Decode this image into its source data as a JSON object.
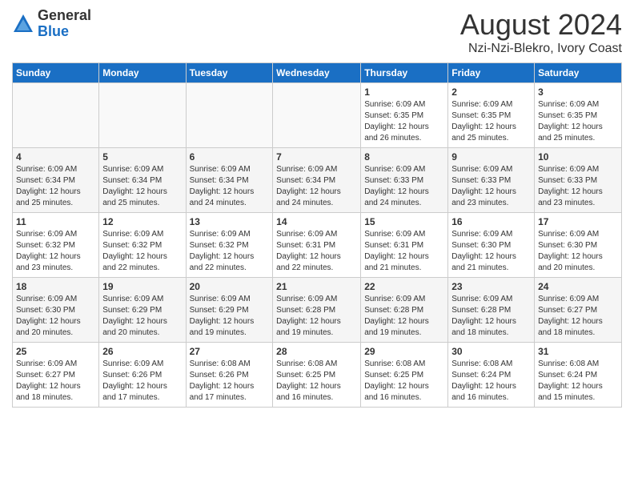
{
  "logo": {
    "general": "General",
    "blue": "Blue"
  },
  "title": "August 2024",
  "location": "Nzi-Nzi-Blekro, Ivory Coast",
  "days_header": [
    "Sunday",
    "Monday",
    "Tuesday",
    "Wednesday",
    "Thursday",
    "Friday",
    "Saturday"
  ],
  "weeks": [
    [
      {
        "day": "",
        "info": ""
      },
      {
        "day": "",
        "info": ""
      },
      {
        "day": "",
        "info": ""
      },
      {
        "day": "",
        "info": ""
      },
      {
        "day": "1",
        "info": "Sunrise: 6:09 AM\nSunset: 6:35 PM\nDaylight: 12 hours\nand 26 minutes."
      },
      {
        "day": "2",
        "info": "Sunrise: 6:09 AM\nSunset: 6:35 PM\nDaylight: 12 hours\nand 25 minutes."
      },
      {
        "day": "3",
        "info": "Sunrise: 6:09 AM\nSunset: 6:35 PM\nDaylight: 12 hours\nand 25 minutes."
      }
    ],
    [
      {
        "day": "4",
        "info": "Sunrise: 6:09 AM\nSunset: 6:34 PM\nDaylight: 12 hours\nand 25 minutes."
      },
      {
        "day": "5",
        "info": "Sunrise: 6:09 AM\nSunset: 6:34 PM\nDaylight: 12 hours\nand 25 minutes."
      },
      {
        "day": "6",
        "info": "Sunrise: 6:09 AM\nSunset: 6:34 PM\nDaylight: 12 hours\nand 24 minutes."
      },
      {
        "day": "7",
        "info": "Sunrise: 6:09 AM\nSunset: 6:34 PM\nDaylight: 12 hours\nand 24 minutes."
      },
      {
        "day": "8",
        "info": "Sunrise: 6:09 AM\nSunset: 6:33 PM\nDaylight: 12 hours\nand 24 minutes."
      },
      {
        "day": "9",
        "info": "Sunrise: 6:09 AM\nSunset: 6:33 PM\nDaylight: 12 hours\nand 23 minutes."
      },
      {
        "day": "10",
        "info": "Sunrise: 6:09 AM\nSunset: 6:33 PM\nDaylight: 12 hours\nand 23 minutes."
      }
    ],
    [
      {
        "day": "11",
        "info": "Sunrise: 6:09 AM\nSunset: 6:32 PM\nDaylight: 12 hours\nand 23 minutes."
      },
      {
        "day": "12",
        "info": "Sunrise: 6:09 AM\nSunset: 6:32 PM\nDaylight: 12 hours\nand 22 minutes."
      },
      {
        "day": "13",
        "info": "Sunrise: 6:09 AM\nSunset: 6:32 PM\nDaylight: 12 hours\nand 22 minutes."
      },
      {
        "day": "14",
        "info": "Sunrise: 6:09 AM\nSunset: 6:31 PM\nDaylight: 12 hours\nand 22 minutes."
      },
      {
        "day": "15",
        "info": "Sunrise: 6:09 AM\nSunset: 6:31 PM\nDaylight: 12 hours\nand 21 minutes."
      },
      {
        "day": "16",
        "info": "Sunrise: 6:09 AM\nSunset: 6:30 PM\nDaylight: 12 hours\nand 21 minutes."
      },
      {
        "day": "17",
        "info": "Sunrise: 6:09 AM\nSunset: 6:30 PM\nDaylight: 12 hours\nand 20 minutes."
      }
    ],
    [
      {
        "day": "18",
        "info": "Sunrise: 6:09 AM\nSunset: 6:30 PM\nDaylight: 12 hours\nand 20 minutes."
      },
      {
        "day": "19",
        "info": "Sunrise: 6:09 AM\nSunset: 6:29 PM\nDaylight: 12 hours\nand 20 minutes."
      },
      {
        "day": "20",
        "info": "Sunrise: 6:09 AM\nSunset: 6:29 PM\nDaylight: 12 hours\nand 19 minutes."
      },
      {
        "day": "21",
        "info": "Sunrise: 6:09 AM\nSunset: 6:28 PM\nDaylight: 12 hours\nand 19 minutes."
      },
      {
        "day": "22",
        "info": "Sunrise: 6:09 AM\nSunset: 6:28 PM\nDaylight: 12 hours\nand 19 minutes."
      },
      {
        "day": "23",
        "info": "Sunrise: 6:09 AM\nSunset: 6:28 PM\nDaylight: 12 hours\nand 18 minutes."
      },
      {
        "day": "24",
        "info": "Sunrise: 6:09 AM\nSunset: 6:27 PM\nDaylight: 12 hours\nand 18 minutes."
      }
    ],
    [
      {
        "day": "25",
        "info": "Sunrise: 6:09 AM\nSunset: 6:27 PM\nDaylight: 12 hours\nand 18 minutes."
      },
      {
        "day": "26",
        "info": "Sunrise: 6:09 AM\nSunset: 6:26 PM\nDaylight: 12 hours\nand 17 minutes."
      },
      {
        "day": "27",
        "info": "Sunrise: 6:08 AM\nSunset: 6:26 PM\nDaylight: 12 hours\nand 17 minutes."
      },
      {
        "day": "28",
        "info": "Sunrise: 6:08 AM\nSunset: 6:25 PM\nDaylight: 12 hours\nand 16 minutes."
      },
      {
        "day": "29",
        "info": "Sunrise: 6:08 AM\nSunset: 6:25 PM\nDaylight: 12 hours\nand 16 minutes."
      },
      {
        "day": "30",
        "info": "Sunrise: 6:08 AM\nSunset: 6:24 PM\nDaylight: 12 hours\nand 16 minutes."
      },
      {
        "day": "31",
        "info": "Sunrise: 6:08 AM\nSunset: 6:24 PM\nDaylight: 12 hours\nand 15 minutes."
      }
    ]
  ]
}
